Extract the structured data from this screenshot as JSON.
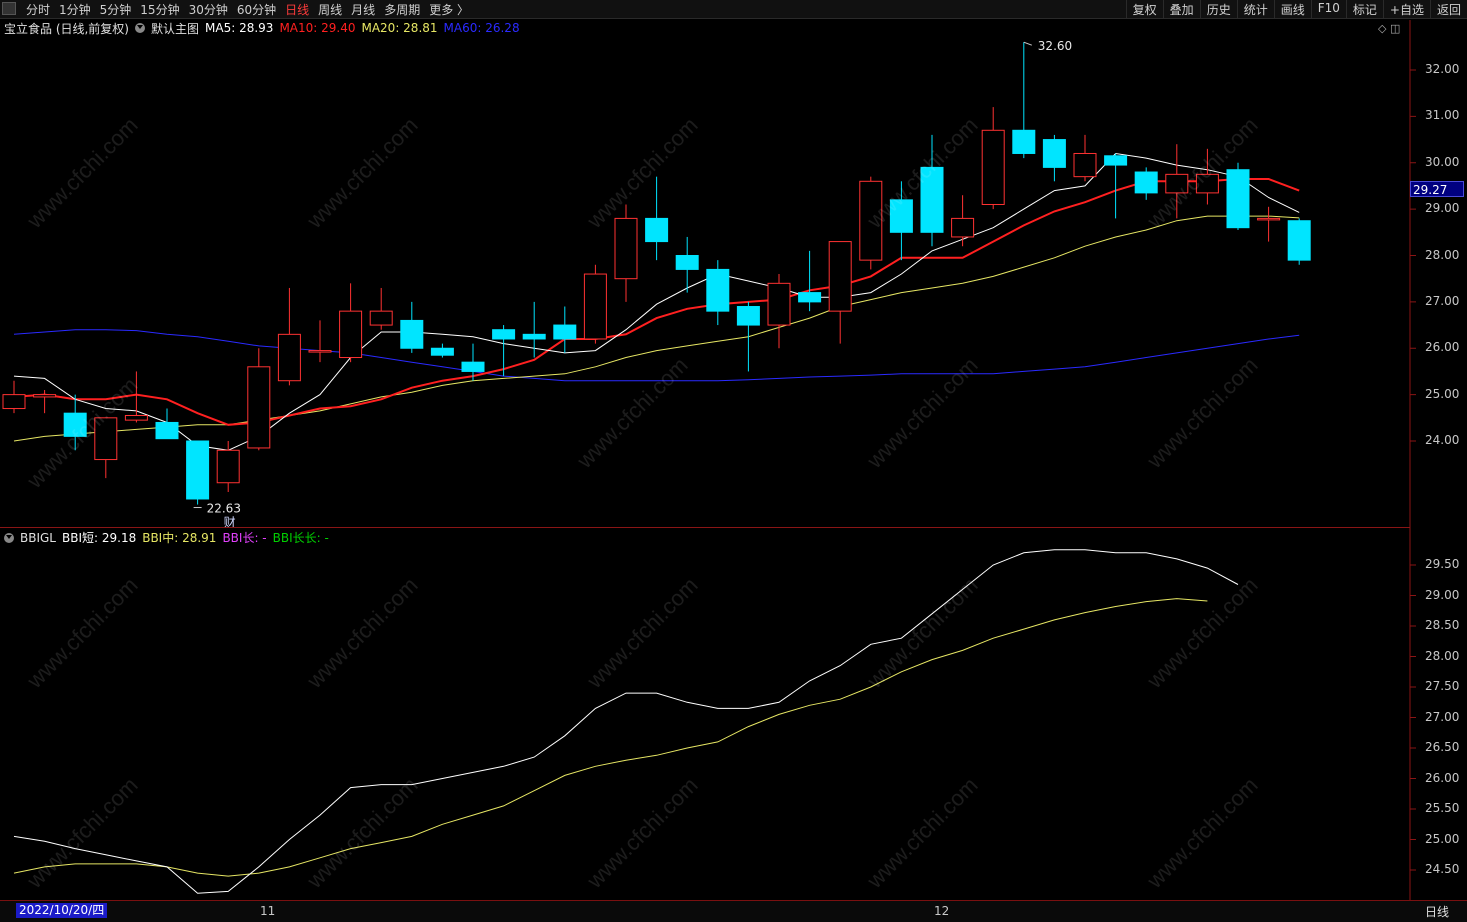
{
  "toolbar": {
    "periods": [
      "分时",
      "1分钟",
      "5分钟",
      "15分钟",
      "30分钟",
      "60分钟",
      "日线",
      "周线",
      "月线",
      "多周期",
      "更多 〉"
    ],
    "active_period": "日线",
    "right_buttons": [
      "复权",
      "叠加",
      "历史",
      "统计",
      "画线",
      "F10",
      "标记",
      "+自选",
      "返回"
    ]
  },
  "main_info": {
    "stock": "宝立食品 (日线,前复权)",
    "template": "默认主图",
    "ma5_label": "MA5: 28.93",
    "ma10_label": "MA10: 29.40",
    "ma20_label": "MA20: 28.81",
    "ma60_label": "MA60: 26.28",
    "window_controls": "◇ ◫"
  },
  "sub_info": {
    "name": "BBIGL",
    "bbi_short_label": "BBI短: 29.18",
    "bbi_mid_label": "BBI中: 28.91",
    "bbi_long_label": "BBI长: -",
    "bbi_longlong_label": "BBI长长: -"
  },
  "colors": {
    "up": "#ff3232",
    "down": "#00e5ff",
    "ma5": "#ffffff",
    "ma10": "#ff2020",
    "ma20": "#e6e664",
    "ma60": "#2a2aff",
    "bbi_long": "#e040fb",
    "bbi_longlong": "#00d000"
  },
  "price_axis": [
    "32.00",
    "31.00",
    "30.00",
    "29.00",
    "28.00",
    "27.00",
    "26.00",
    "25.00",
    "24.00"
  ],
  "sub_axis": [
    "29.50",
    "29.00",
    "28.50",
    "28.00",
    "27.50",
    "27.00",
    "26.50",
    "26.00",
    "25.50",
    "25.00",
    "24.50"
  ],
  "current_price": "29.27",
  "high_marker": "32.60",
  "low_marker": "22.63",
  "event_marker": "财",
  "bottom": {
    "start_date": "2022/10/20/四",
    "tick_11": "11",
    "tick_12": "12",
    "period": "日线"
  },
  "watermark_text": "www.cfchi.com",
  "chart_data": {
    "type": "candlestick",
    "candles": [
      {
        "o": 24.7,
        "h": 25.3,
        "l": 24.6,
        "c": 25.0
      },
      {
        "o": 24.95,
        "h": 25.1,
        "l": 24.6,
        "c": 25.0
      },
      {
        "o": 24.6,
        "h": 25.0,
        "l": 23.8,
        "c": 24.1
      },
      {
        "o": 23.6,
        "h": 24.5,
        "l": 23.2,
        "c": 24.5
      },
      {
        "o": 24.45,
        "h": 25.5,
        "l": 24.4,
        "c": 24.55
      },
      {
        "o": 24.4,
        "h": 24.7,
        "l": 24.05,
        "c": 24.05
      },
      {
        "o": 24.0,
        "h": 24.0,
        "l": 22.63,
        "c": 22.75
      },
      {
        "o": 23.1,
        "h": 24.0,
        "l": 22.9,
        "c": 23.8
      },
      {
        "o": 23.85,
        "h": 26.0,
        "l": 23.8,
        "c": 25.6
      },
      {
        "o": 25.3,
        "h": 27.3,
        "l": 25.2,
        "c": 26.3
      },
      {
        "o": 25.95,
        "h": 26.6,
        "l": 25.7,
        "c": 25.95
      },
      {
        "o": 25.8,
        "h": 27.4,
        "l": 25.7,
        "c": 26.8
      },
      {
        "o": 26.5,
        "h": 27.3,
        "l": 26.4,
        "c": 26.8
      },
      {
        "o": 26.6,
        "h": 27.0,
        "l": 25.9,
        "c": 26.0
      },
      {
        "o": 26.0,
        "h": 26.1,
        "l": 25.8,
        "c": 25.85
      },
      {
        "o": 25.7,
        "h": 26.1,
        "l": 25.3,
        "c": 25.5
      },
      {
        "o": 26.4,
        "h": 26.5,
        "l": 25.4,
        "c": 26.2
      },
      {
        "o": 26.3,
        "h": 27.0,
        "l": 25.8,
        "c": 26.2
      },
      {
        "o": 26.5,
        "h": 26.9,
        "l": 25.9,
        "c": 26.2
      },
      {
        "o": 26.2,
        "h": 27.8,
        "l": 26.1,
        "c": 27.6
      },
      {
        "o": 27.5,
        "h": 29.1,
        "l": 27.0,
        "c": 28.8
      },
      {
        "o": 28.8,
        "h": 29.7,
        "l": 27.9,
        "c": 28.3
      },
      {
        "o": 28.0,
        "h": 28.4,
        "l": 27.2,
        "c": 27.7
      },
      {
        "o": 27.7,
        "h": 27.9,
        "l": 26.5,
        "c": 26.8
      },
      {
        "o": 26.9,
        "h": 27.0,
        "l": 25.5,
        "c": 26.5
      },
      {
        "o": 26.5,
        "h": 27.6,
        "l": 26.0,
        "c": 27.4
      },
      {
        "o": 27.2,
        "h": 28.1,
        "l": 26.8,
        "c": 27.0
      },
      {
        "o": 26.8,
        "h": 28.3,
        "l": 26.1,
        "c": 28.3
      },
      {
        "o": 27.9,
        "h": 29.7,
        "l": 27.7,
        "c": 29.6
      },
      {
        "o": 29.2,
        "h": 29.6,
        "l": 27.9,
        "c": 28.5
      },
      {
        "o": 29.9,
        "h": 30.6,
        "l": 28.2,
        "c": 28.5
      },
      {
        "o": 28.4,
        "h": 29.3,
        "l": 28.2,
        "c": 28.8
      },
      {
        "o": 29.1,
        "h": 31.2,
        "l": 29.0,
        "c": 30.7
      },
      {
        "o": 30.7,
        "h": 32.6,
        "l": 30.1,
        "c": 30.2
      },
      {
        "o": 30.5,
        "h": 30.6,
        "l": 29.6,
        "c": 29.9
      },
      {
        "o": 29.7,
        "h": 30.6,
        "l": 29.6,
        "c": 30.2
      },
      {
        "o": 30.15,
        "h": 30.2,
        "l": 28.8,
        "c": 29.95
      },
      {
        "o": 29.8,
        "h": 29.9,
        "l": 29.2,
        "c": 29.35
      },
      {
        "o": 29.35,
        "h": 30.4,
        "l": 28.8,
        "c": 29.75
      },
      {
        "o": 29.35,
        "h": 30.3,
        "l": 29.1,
        "c": 29.75
      },
      {
        "o": 29.85,
        "h": 30.0,
        "l": 28.55,
        "c": 28.6
      },
      {
        "o": 28.8,
        "h": 29.05,
        "l": 28.3,
        "c": 28.8
      },
      {
        "o": 28.75,
        "h": 28.8,
        "l": 27.8,
        "c": 27.9
      }
    ],
    "ma5": [
      25.4,
      25.35,
      24.9,
      24.7,
      24.65,
      24.4,
      23.9,
      23.8,
      24.1,
      24.6,
      25.0,
      25.8,
      26.35,
      26.35,
      26.3,
      26.25,
      26.1,
      26.0,
      25.9,
      25.95,
      26.4,
      26.95,
      27.3,
      27.6,
      27.45,
      27.3,
      27.1,
      27.1,
      27.2,
      27.6,
      28.1,
      28.35,
      28.6,
      29.0,
      29.4,
      29.5,
      30.2,
      30.1,
      29.95,
      29.85,
      29.7,
      29.25,
      28.93
    ],
    "ma10": [
      24.95,
      25.0,
      24.9,
      24.9,
      25.0,
      24.9,
      24.6,
      24.35,
      24.4,
      24.55,
      24.7,
      24.75,
      24.9,
      25.15,
      25.3,
      25.4,
      25.55,
      25.75,
      26.2,
      26.2,
      26.3,
      26.65,
      26.85,
      26.95,
      27.0,
      27.05,
      27.25,
      27.35,
      27.55,
      27.95,
      27.95,
      27.95,
      28.3,
      28.65,
      28.95,
      29.15,
      29.4,
      29.6,
      29.6,
      29.6,
      29.65,
      29.65,
      29.4
    ],
    "ma20": [
      24.0,
      24.1,
      24.15,
      24.2,
      24.25,
      24.3,
      24.35,
      24.35,
      24.45,
      24.55,
      24.65,
      24.8,
      24.95,
      25.05,
      25.2,
      25.3,
      25.35,
      25.4,
      25.45,
      25.6,
      25.8,
      25.95,
      26.05,
      26.15,
      26.25,
      26.45,
      26.65,
      26.9,
      27.05,
      27.2,
      27.3,
      27.4,
      27.55,
      27.75,
      27.95,
      28.2,
      28.4,
      28.55,
      28.75,
      28.85,
      28.85,
      28.85,
      28.81
    ],
    "ma60": [
      26.3,
      26.35,
      26.4,
      26.4,
      26.38,
      26.3,
      26.25,
      26.15,
      26.05,
      26.0,
      25.95,
      25.9,
      25.8,
      25.7,
      25.6,
      25.5,
      25.4,
      25.35,
      25.3,
      25.3,
      25.3,
      25.3,
      25.3,
      25.3,
      25.32,
      25.35,
      25.38,
      25.4,
      25.42,
      25.45,
      25.45,
      25.45,
      25.45,
      25.5,
      25.55,
      25.6,
      25.7,
      25.8,
      25.9,
      26.0,
      26.1,
      26.2,
      26.28
    ],
    "bbi_short": [
      25.05,
      24.97,
      24.85,
      24.75,
      24.65,
      24.55,
      24.12,
      24.15,
      24.55,
      25.0,
      25.4,
      25.85,
      25.9,
      25.9,
      26.0,
      26.1,
      26.2,
      26.35,
      26.7,
      27.15,
      27.4,
      27.4,
      27.25,
      27.15,
      27.15,
      27.25,
      27.6,
      27.85,
      28.2,
      28.3,
      28.7,
      29.1,
      29.5,
      29.7,
      29.75,
      29.75,
      29.7,
      29.7,
      29.6,
      29.45,
      29.18
    ],
    "bbi_mid": [
      24.45,
      24.55,
      24.6,
      24.6,
      24.6,
      24.55,
      24.45,
      24.4,
      24.45,
      24.55,
      24.7,
      24.85,
      24.95,
      25.05,
      25.25,
      25.4,
      25.55,
      25.8,
      26.05,
      26.2,
      26.3,
      26.38,
      26.5,
      26.6,
      26.85,
      27.05,
      27.2,
      27.3,
      27.5,
      27.75,
      27.95,
      28.1,
      28.3,
      28.45,
      28.6,
      28.72,
      28.82,
      28.9,
      28.95,
      28.91
    ]
  }
}
